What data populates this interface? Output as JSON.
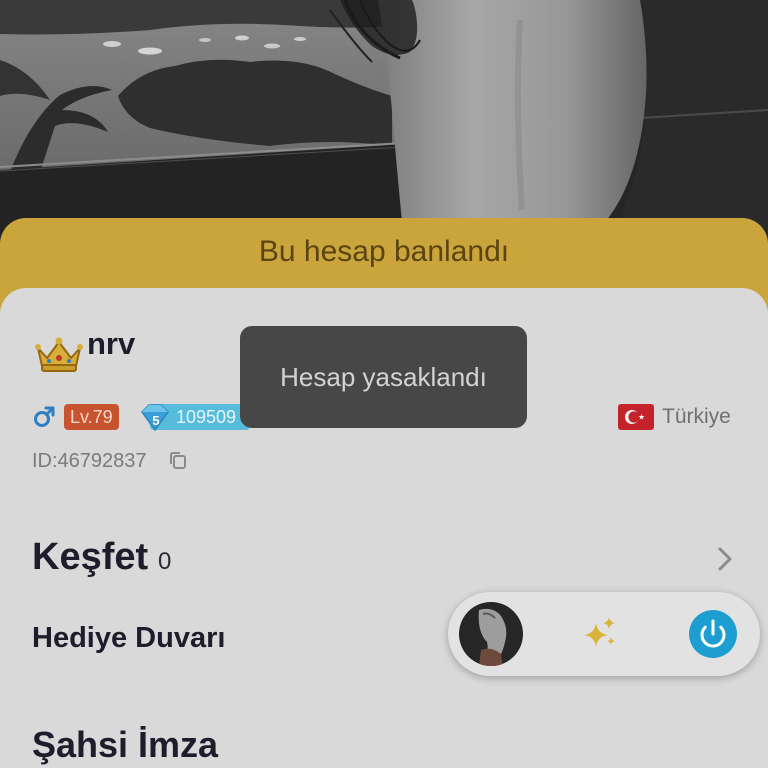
{
  "banner": {
    "text": "Bu hesap banlandı"
  },
  "profile": {
    "crown_icon": "crown-icon",
    "username": "nrv",
    "gender_icon": "male-icon",
    "level": "Lv.79",
    "diamond_icon": "diamond-icon",
    "diamond_level": "5",
    "diamond_count": "109509",
    "flag_icon": "turkey-flag-icon",
    "country": "Türkiye",
    "id": "ID:46792837",
    "copy_icon": "copy-icon"
  },
  "sections": {
    "explore": {
      "title": "Keşfet",
      "count": "0",
      "icon": "chevron-right-icon"
    },
    "gift_wall": {
      "title": "Hediye Duvarı"
    },
    "signature": {
      "title": "Şahsi İmza"
    }
  },
  "floating_bar": {
    "avatar_icon": "avatar",
    "effects_icon": "sparkles-icon",
    "power_icon": "power-icon"
  },
  "toast": {
    "text": "Hesap yasaklandı"
  },
  "colors": {
    "banner": "#c9a53c",
    "banner_text": "#5b4410",
    "card": "#d9d9d9",
    "text_dark": "#1d1d2b",
    "text_muted": "#717171",
    "level_badge": "#c8542f",
    "diamond_badge": "#57bbdb",
    "gender_blue": "#2c7fc4",
    "power_button": "#1c9fd0",
    "toast_bg": "#474747",
    "toast_text": "#d3d3d3"
  }
}
